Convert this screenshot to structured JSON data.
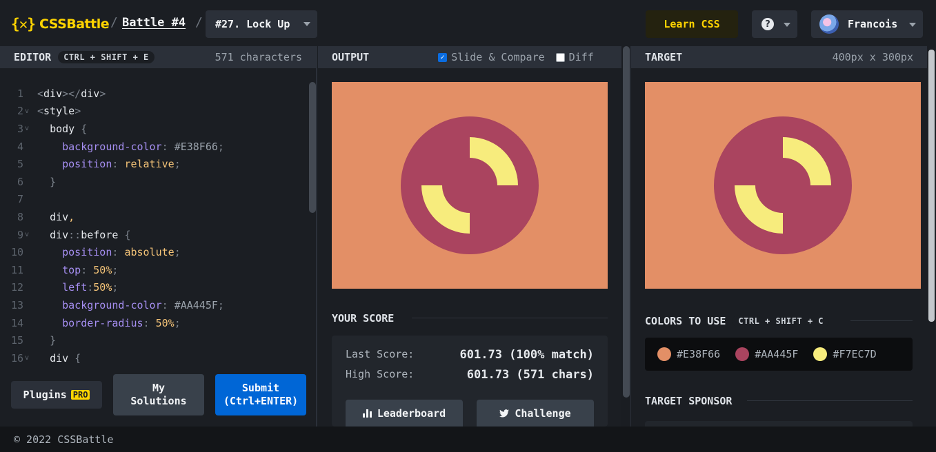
{
  "header": {
    "logo_mark": "{✕}",
    "logo_text": "CSSBattle",
    "sep": "/",
    "battle_label": "Battle #4",
    "target_label": "#27. Lock Up",
    "learn_label": "Learn CSS",
    "help_label": "?",
    "user_name": "Francois"
  },
  "editor": {
    "title": "EDITOR",
    "shortcut": "CTRL + SHIFT + E",
    "char_count": "571 characters",
    "lines": [
      {
        "n": "1",
        "fold": "",
        "html": "<span class='c-punct'>&lt;</span><span class='c-tag'>div</span><span class='c-punct'>&gt;&lt;/</span><span class='c-tag'>div</span><span class='c-punct'>&gt;</span>"
      },
      {
        "n": "2",
        "fold": "v",
        "html": "<span class='c-punct'>&lt;</span><span class='c-tag'>style</span><span class='c-punct'>&gt;</span>"
      },
      {
        "n": "3",
        "fold": "v",
        "html": "  <span class='c-sel'>body</span> <span class='c-punct'>{</span>"
      },
      {
        "n": "4",
        "fold": "",
        "html": "    <span class='c-prop'>background-color</span><span class='c-punct'>:</span> <span class='c-hex'>#E38F66</span><span class='c-punct'>;</span>"
      },
      {
        "n": "5",
        "fold": "",
        "html": "    <span class='c-prop'>position</span><span class='c-punct'>:</span> <span class='c-val'>relative</span><span class='c-punct'>;</span>"
      },
      {
        "n": "6",
        "fold": "",
        "html": "  <span class='c-punct'>}</span>"
      },
      {
        "n": "7",
        "fold": "",
        "html": ""
      },
      {
        "n": "8",
        "fold": "",
        "html": "  <span class='c-sel'>div</span><span class='c-val'>,</span>"
      },
      {
        "n": "9",
        "fold": "v",
        "html": "  <span class='c-sel'>div</span><span class='c-punct'>::</span><span class='c-sel'>before</span> <span class='c-punct'>{</span>"
      },
      {
        "n": "10",
        "fold": "",
        "html": "    <span class='c-prop'>position</span><span class='c-punct'>:</span> <span class='c-val'>absolute</span><span class='c-punct'>;</span>"
      },
      {
        "n": "11",
        "fold": "",
        "html": "    <span class='c-prop'>top</span><span class='c-punct'>:</span> <span class='c-num'>50%</span><span class='c-punct'>;</span>"
      },
      {
        "n": "12",
        "fold": "",
        "html": "    <span class='c-prop'>left</span><span class='c-punct'>:</span><span class='c-num'>50%</span><span class='c-punct'>;</span>"
      },
      {
        "n": "13",
        "fold": "",
        "html": "    <span class='c-prop'>background-color</span><span class='c-punct'>:</span> <span class='c-hex'>#AA445F</span><span class='c-punct'>;</span>"
      },
      {
        "n": "14",
        "fold": "",
        "html": "    <span class='c-prop'>border-radius</span><span class='c-punct'>:</span> <span class='c-num'>50%</span><span class='c-punct'>;</span>"
      },
      {
        "n": "15",
        "fold": "",
        "html": "  <span class='c-punct'>}</span>"
      },
      {
        "n": "16",
        "fold": "v",
        "html": "  <span class='c-sel'>div</span> <span class='c-punct'>{</span>"
      }
    ],
    "plugins_label": "Plugins",
    "pro_label": "PRO",
    "mysol_label_1": "My",
    "mysol_label_2": "Solutions",
    "submit_label_1": "Submit",
    "submit_label_2": "(Ctrl+ENTER)"
  },
  "output": {
    "title": "OUTPUT",
    "slide_label": "Slide & Compare",
    "slide_checked": true,
    "diff_label": "Diff",
    "diff_checked": false,
    "score_title": "YOUR SCORE",
    "last_label": "Last Score:",
    "last_value": "601.73 (100% match)",
    "high_label": "High Score:",
    "high_value": "601.73 (571 chars)",
    "leaderboard_label": "Leaderboard",
    "challenge_label": "Challenge"
  },
  "target": {
    "title": "TARGET",
    "dims": "400px x 300px",
    "colors_title": "COLORS TO USE",
    "colors_shortcut": "CTRL + SHIFT + C",
    "colors": [
      {
        "hex": "#E38F66"
      },
      {
        "hex": "#AA445F"
      },
      {
        "hex": "#F7EC7D"
      }
    ],
    "sponsor_title": "TARGET SPONSOR"
  },
  "footer": {
    "copyright": "© 2022 CSSBattle"
  }
}
